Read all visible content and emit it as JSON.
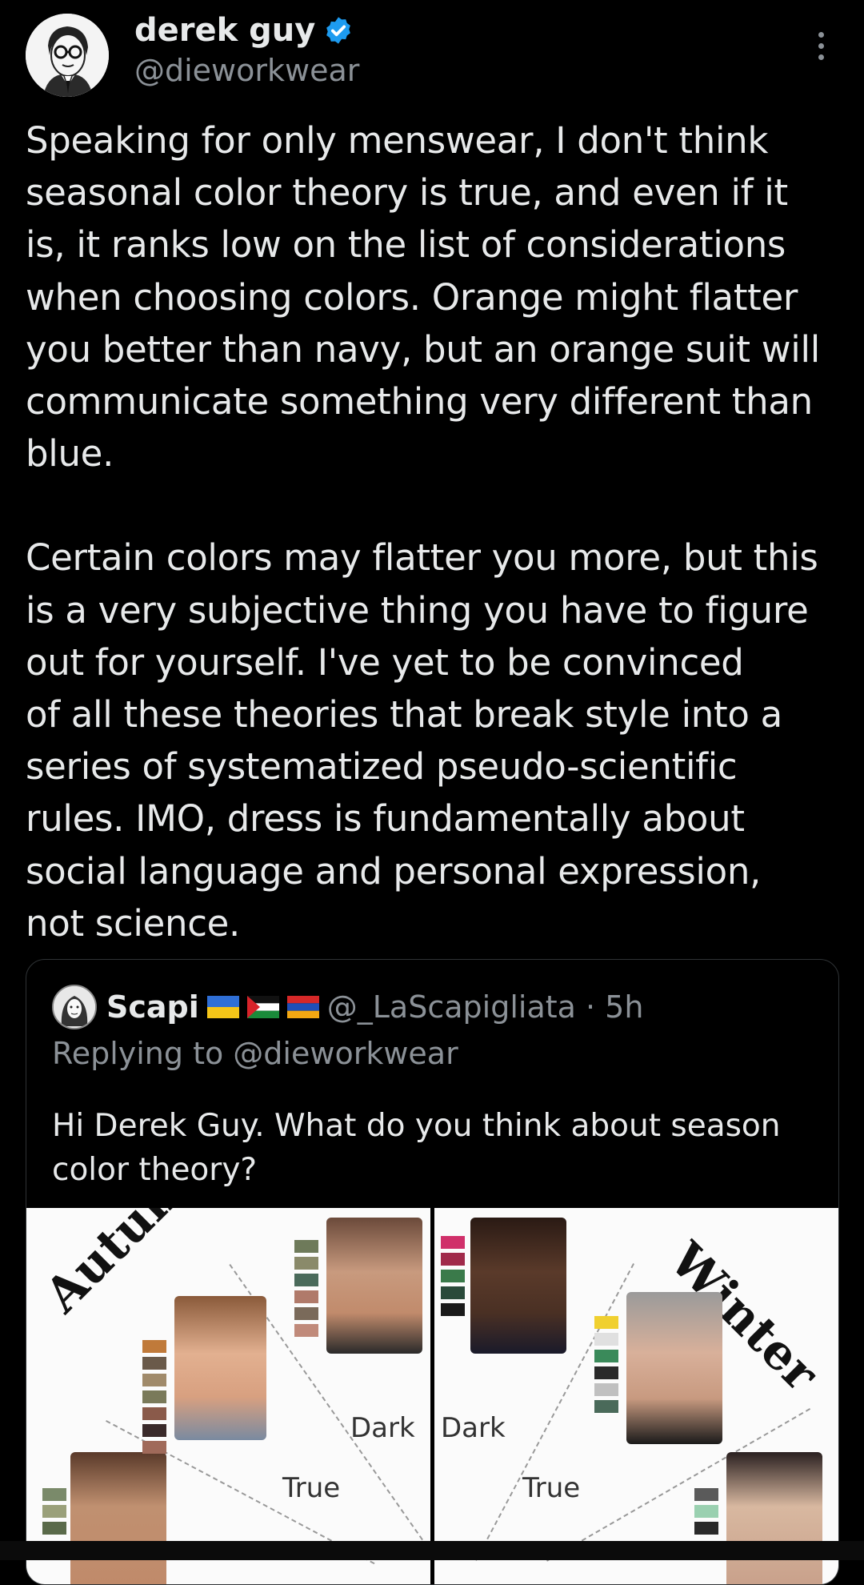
{
  "author": {
    "name": "derek guy",
    "handle": "@dieworkwear",
    "verified_icon": "verified-badge-icon",
    "accent": "#1d9bf0"
  },
  "tweet": {
    "paragraph1": "Speaking for only menswear, I don't think\nseasonal color theory is true, and even if it\nis, it ranks low on the list of considerations\nwhen choosing colors. Orange might flatter\nyou better than navy, but an orange suit will\ncommunicate something very different than\nblue.",
    "paragraph2": "Certain colors may flatter you more, but this\nis a very subjective thing you have to figure\nout for yourself. I've yet to be convinced\nof all these theories that break style into a\nseries of systematized pseudo-scientific\nrules. IMO, dress is fundamentally about\nsocial language and personal expression,\nnot science."
  },
  "quote": {
    "name": "Scapi",
    "flags": [
      "ukraine-flag-icon",
      "palestine-flag-icon",
      "armenia-flag-icon"
    ],
    "handle_time": "@_LaScapigliata · 5h",
    "replying_to": "Replying to @dieworkwear",
    "text": "Hi Derek Guy. What do you think about season color theory?",
    "image": {
      "left": {
        "season": "Autumn",
        "labels": [
          "Dark",
          "True"
        ]
      },
      "right": {
        "season": "Winter",
        "labels": [
          "Dark",
          "True"
        ]
      }
    }
  }
}
